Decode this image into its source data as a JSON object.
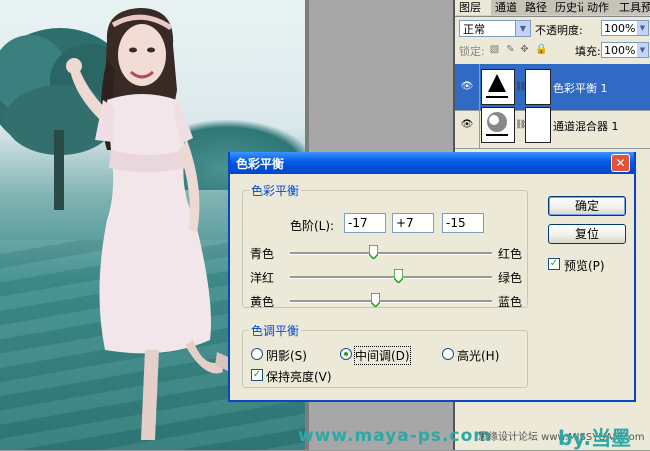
{
  "layers_panel": {
    "tabs": [
      "图层",
      "通道",
      "路径",
      "历史记录",
      "动作",
      "工具预设"
    ],
    "blend_mode": "正常",
    "opacity_label": "不透明度:",
    "opacity_value": "100%",
    "lock_label": "锁定:",
    "fill_label": "填充:",
    "fill_value": "100%",
    "layers": [
      {
        "name": "色彩平衡 1",
        "selected": true
      },
      {
        "name": "通道混合器 1",
        "selected": false
      }
    ]
  },
  "dialog": {
    "title": "色彩平衡",
    "color_balance_group": "色彩平衡",
    "levels_label": "色阶(L):",
    "levels": [
      "-17",
      "+7",
      "-15"
    ],
    "sliders": [
      {
        "left": "青色",
        "right": "红色",
        "value": -17
      },
      {
        "left": "洋红",
        "right": "绿色",
        "value": 7
      },
      {
        "left": "黄色",
        "right": "蓝色",
        "value": -15
      }
    ],
    "tone_group": "色调平衡",
    "tones": [
      {
        "label": "阴影(S)",
        "selected": false
      },
      {
        "label": "中间调(D)",
        "selected": true
      },
      {
        "label": "高光(H)",
        "selected": false
      }
    ],
    "preserve_luminosity": "保持亮度(V)",
    "ok": "确定",
    "reset": "复位",
    "preview": "预览(P)"
  },
  "watermark": {
    "site": "www.maya-ps.com",
    "forum": "思缘设计论坛 www.MISSYUAN.com",
    "credit": "by.当墨"
  },
  "colors": {
    "titlebar": "#0058e6",
    "selection": "#316ac5",
    "accent_green": "#21a121"
  }
}
